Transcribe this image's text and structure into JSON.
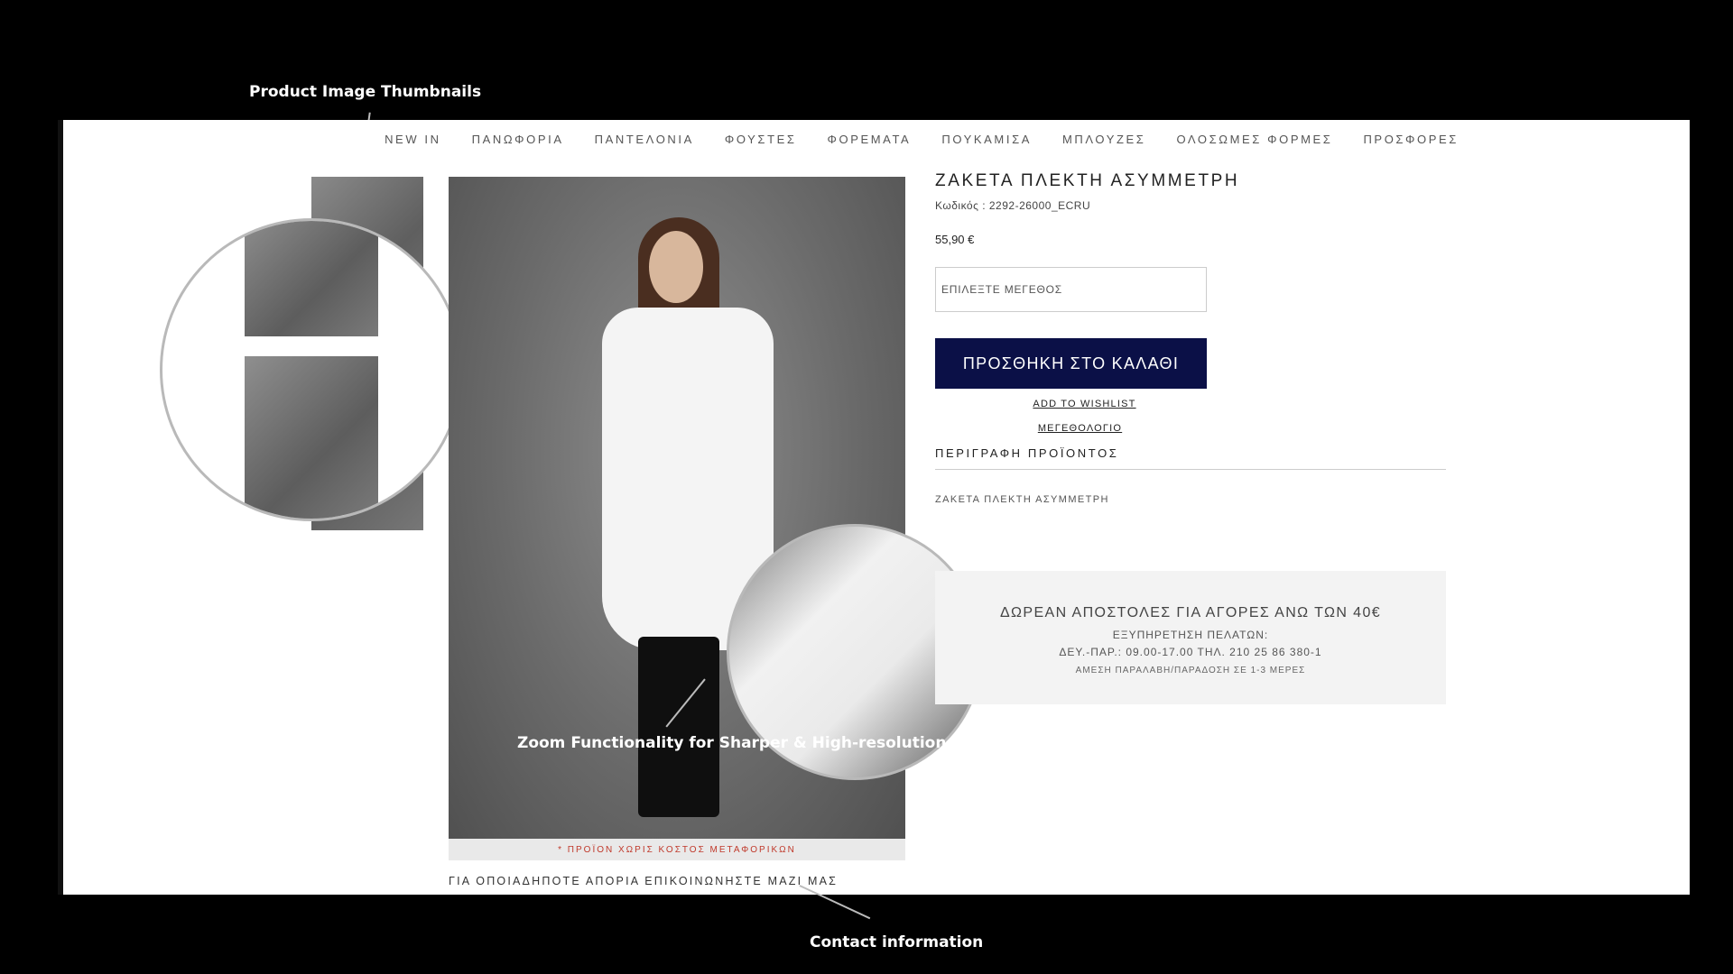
{
  "annotations": {
    "thumbnails": "Product Image Thumbnails",
    "zoom": "Zoom Functionality for Sharper & High-resolution",
    "contact": "Contact information"
  },
  "nav": {
    "items": [
      {
        "label": "NEW IN"
      },
      {
        "label": "ΠΑΝΩΦΟΡΙΑ"
      },
      {
        "label": "ΠΑΝΤΕΛΟΝΙΑ"
      },
      {
        "label": "ΦΟΥΣΤΕΣ"
      },
      {
        "label": "ΦΟΡΕΜΑΤΑ"
      },
      {
        "label": "ΠΟΥΚΑΜΙΣΑ"
      },
      {
        "label": "ΜΠΛΟΥΖΕΣ"
      },
      {
        "label": "ΟΛΟΣΩΜΕΣ ΦΟΡΜΕΣ"
      },
      {
        "label": "ΠΡΟΣΦΟΡΕΣ"
      }
    ]
  },
  "product": {
    "title": "ΖΑΚΕΤΑ ΠΛΕΚΤΗ ΑΣΥΜΜΕΤΡΗ",
    "code": "Κωδικός : 2292-26000_ECRU",
    "price": "55,90 €",
    "size_placeholder": "ΕΠΙΛΕΞΤΕ ΜΕΓΕΘΟΣ",
    "add_to_cart": "ΠΡΟΣΘΗΚΗ ΣΤΟ ΚΑΛΑΘΙ",
    "wishlist": "ADD TO WISHLIST",
    "size_chart": "ΜΕΓΕΘΟΛΟΓΙΟ",
    "description_header": "ΠΕΡΙΓΡΑΦΗ ΠΡΟΪΟΝΤΟΣ",
    "description_text": "ΖΑΚΕΤΑ ΠΛΕΚΤΗ ΑΣΥΜΜΕΤΡΗ",
    "shipping_note": "* ΠΡΟΪΟΝ ΧΩΡΙΣ ΚΟΣΤΟΣ ΜΕΤΑΦΟΡΙΚΩΝ"
  },
  "promo": {
    "title": "ΔΩΡΕΑΝ ΑΠΟΣΤΟΛΕΣ ΓΙΑ ΑΓΟΡΕΣ ΑΝΩ ΤΩΝ 40€",
    "line1": "ΕΞΥΠΗΡΕΤΗΣΗ ΠΕΛΑΤΩΝ:",
    "line2": "ΔΕΥ.-ΠΑΡ.: 09.00-17.00 ΤΗΛ. 210 25 86 380-1",
    "line3": "ΑΜΕΣΗ ΠΑΡΑΛΑΒΗ/ΠΑΡΑΔΟΣΗ ΣΕ 1-3 ΜΕΡΕΣ"
  },
  "contact": {
    "text": "ΓΙΑ ΟΠΟΙΑΔΗΠΟΤΕ ΑΠΟΡΙΑ ΕΠΙΚΟΙΝΩΝΗΣΤΕ ΜΑΖΙ ΜΑΣ"
  },
  "colors": {
    "background": "#000000",
    "page": "#ffffff",
    "accent_button": "#0b1047",
    "shipping_note": "#c0392b"
  }
}
